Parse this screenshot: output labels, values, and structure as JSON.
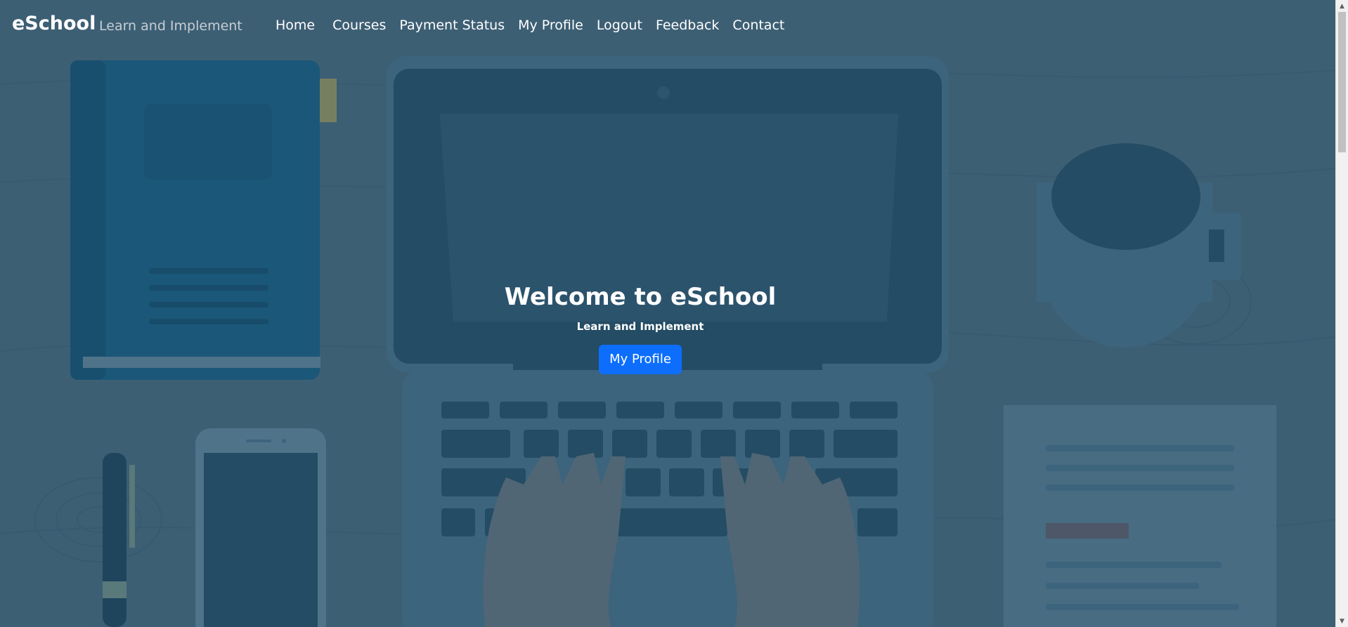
{
  "brand": {
    "name": "eSchool",
    "tagline": "Learn and Implement"
  },
  "nav": {
    "items": [
      {
        "label": "Home"
      },
      {
        "label": "Courses"
      },
      {
        "label": "Payment Status"
      },
      {
        "label": "My Profile"
      },
      {
        "label": "Logout"
      },
      {
        "label": "Feedback"
      },
      {
        "label": "Contact"
      }
    ]
  },
  "hero": {
    "title": "Welcome to eSchool",
    "subtitle": "Learn and Implement",
    "button_label": "My Profile"
  },
  "colors": {
    "button": "#0d6efd",
    "overlay": "#193a50"
  },
  "icons": {
    "scroll_up": "triangle-up-icon",
    "scroll_down": "triangle-down-icon"
  }
}
